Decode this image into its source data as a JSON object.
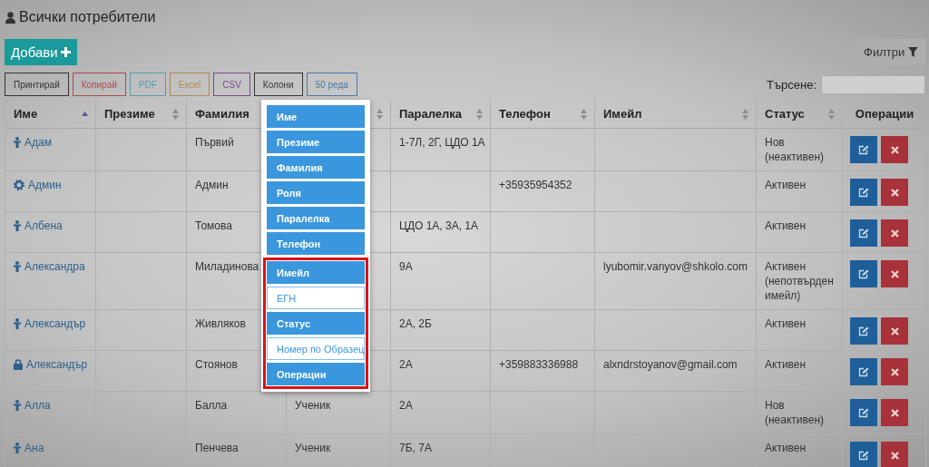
{
  "title": "Всички потребители",
  "add_button": "Добави",
  "filter_button": "Филтри",
  "export_buttons": [
    {
      "label": "Принтирай",
      "color": "#333333"
    },
    {
      "label": "Копирай",
      "color": "#b04848"
    },
    {
      "label": "PDF",
      "color": "#5a9ab0"
    },
    {
      "label": "Excel",
      "color": "#b08850"
    },
    {
      "label": "CSV",
      "color": "#7a4a90"
    },
    {
      "label": "Колони",
      "color": "#333333"
    },
    {
      "label": "50 реда",
      "color": "#4a78a8"
    }
  ],
  "search": {
    "label": "Търсене:"
  },
  "columns": [
    {
      "label": "Име",
      "sorted": true
    },
    {
      "label": "Презиме",
      "sorted": false
    },
    {
      "label": "Фамилия"
    },
    {
      "sorted": false
    },
    {
      "label": "Паралелка",
      "sorted": false
    },
    {
      "label": "Телефон",
      "sorted": false
    },
    {
      "label": "Имейл",
      "sorted": false
    },
    {
      "label": "Статус",
      "sorted": false
    },
    {
      "label": "Операции"
    }
  ],
  "rows": [
    {
      "kind": "student",
      "name": "Адам",
      "last": "Първий",
      "class": "1-7Л, 2Г, ЦДО 1А",
      "status": "Нов (неактивен)"
    },
    {
      "kind": "admin",
      "name": "Админ",
      "last": "Админ",
      "phone": "+35935954352",
      "status": "Активен"
    },
    {
      "kind": "student",
      "name": "Албена",
      "last": "Томова",
      "class": "ЦДО 1А, 3А, 1А",
      "status": "Активен"
    },
    {
      "kind": "student",
      "name": "Александра",
      "last": "Миладинова",
      "class": "9А",
      "email": "lyubomir.vanyov@shkolo.com",
      "status": "Активен (непотвърден имейл)"
    },
    {
      "kind": "student",
      "name": "Александър",
      "last": "Живляков",
      "class": "2А, 2Б",
      "status": "Активен"
    },
    {
      "kind": "locked",
      "name": "Александър",
      "last": "Стоянов",
      "class": "2А",
      "phone": "+359883336988",
      "email": "alxndrstoyanov@gmail.com",
      "status": "Активен"
    },
    {
      "kind": "student",
      "name": "Алла",
      "last": "Балла",
      "role": "Ученик",
      "class": "2А",
      "status": "Нов (неактивен)"
    },
    {
      "kind": "student",
      "name": "Ана",
      "last": "Пенчева",
      "role": "Ученик",
      "class": "7Б, 7А",
      "status": "Активен"
    }
  ],
  "column_menu": [
    {
      "label": "Име",
      "selected": true,
      "highlighted": false
    },
    {
      "label": "Презиме",
      "selected": true,
      "highlighted": false
    },
    {
      "label": "Фамилия",
      "selected": true,
      "highlighted": false
    },
    {
      "label": "Роля",
      "selected": true,
      "highlighted": false
    },
    {
      "label": "Паралелка",
      "selected": true,
      "highlighted": false
    },
    {
      "label": "Телефон",
      "selected": true,
      "highlighted": false
    },
    {
      "label": "Имейл",
      "selected": true,
      "highlighted": true
    },
    {
      "label": "ЕГН",
      "selected": false,
      "highlighted": true
    },
    {
      "label": "Статус",
      "selected": true,
      "highlighted": true
    },
    {
      "label": "Номер по Образец",
      "selected": false,
      "highlighted": true
    },
    {
      "label": "Операции",
      "selected": true,
      "highlighted": true
    }
  ]
}
